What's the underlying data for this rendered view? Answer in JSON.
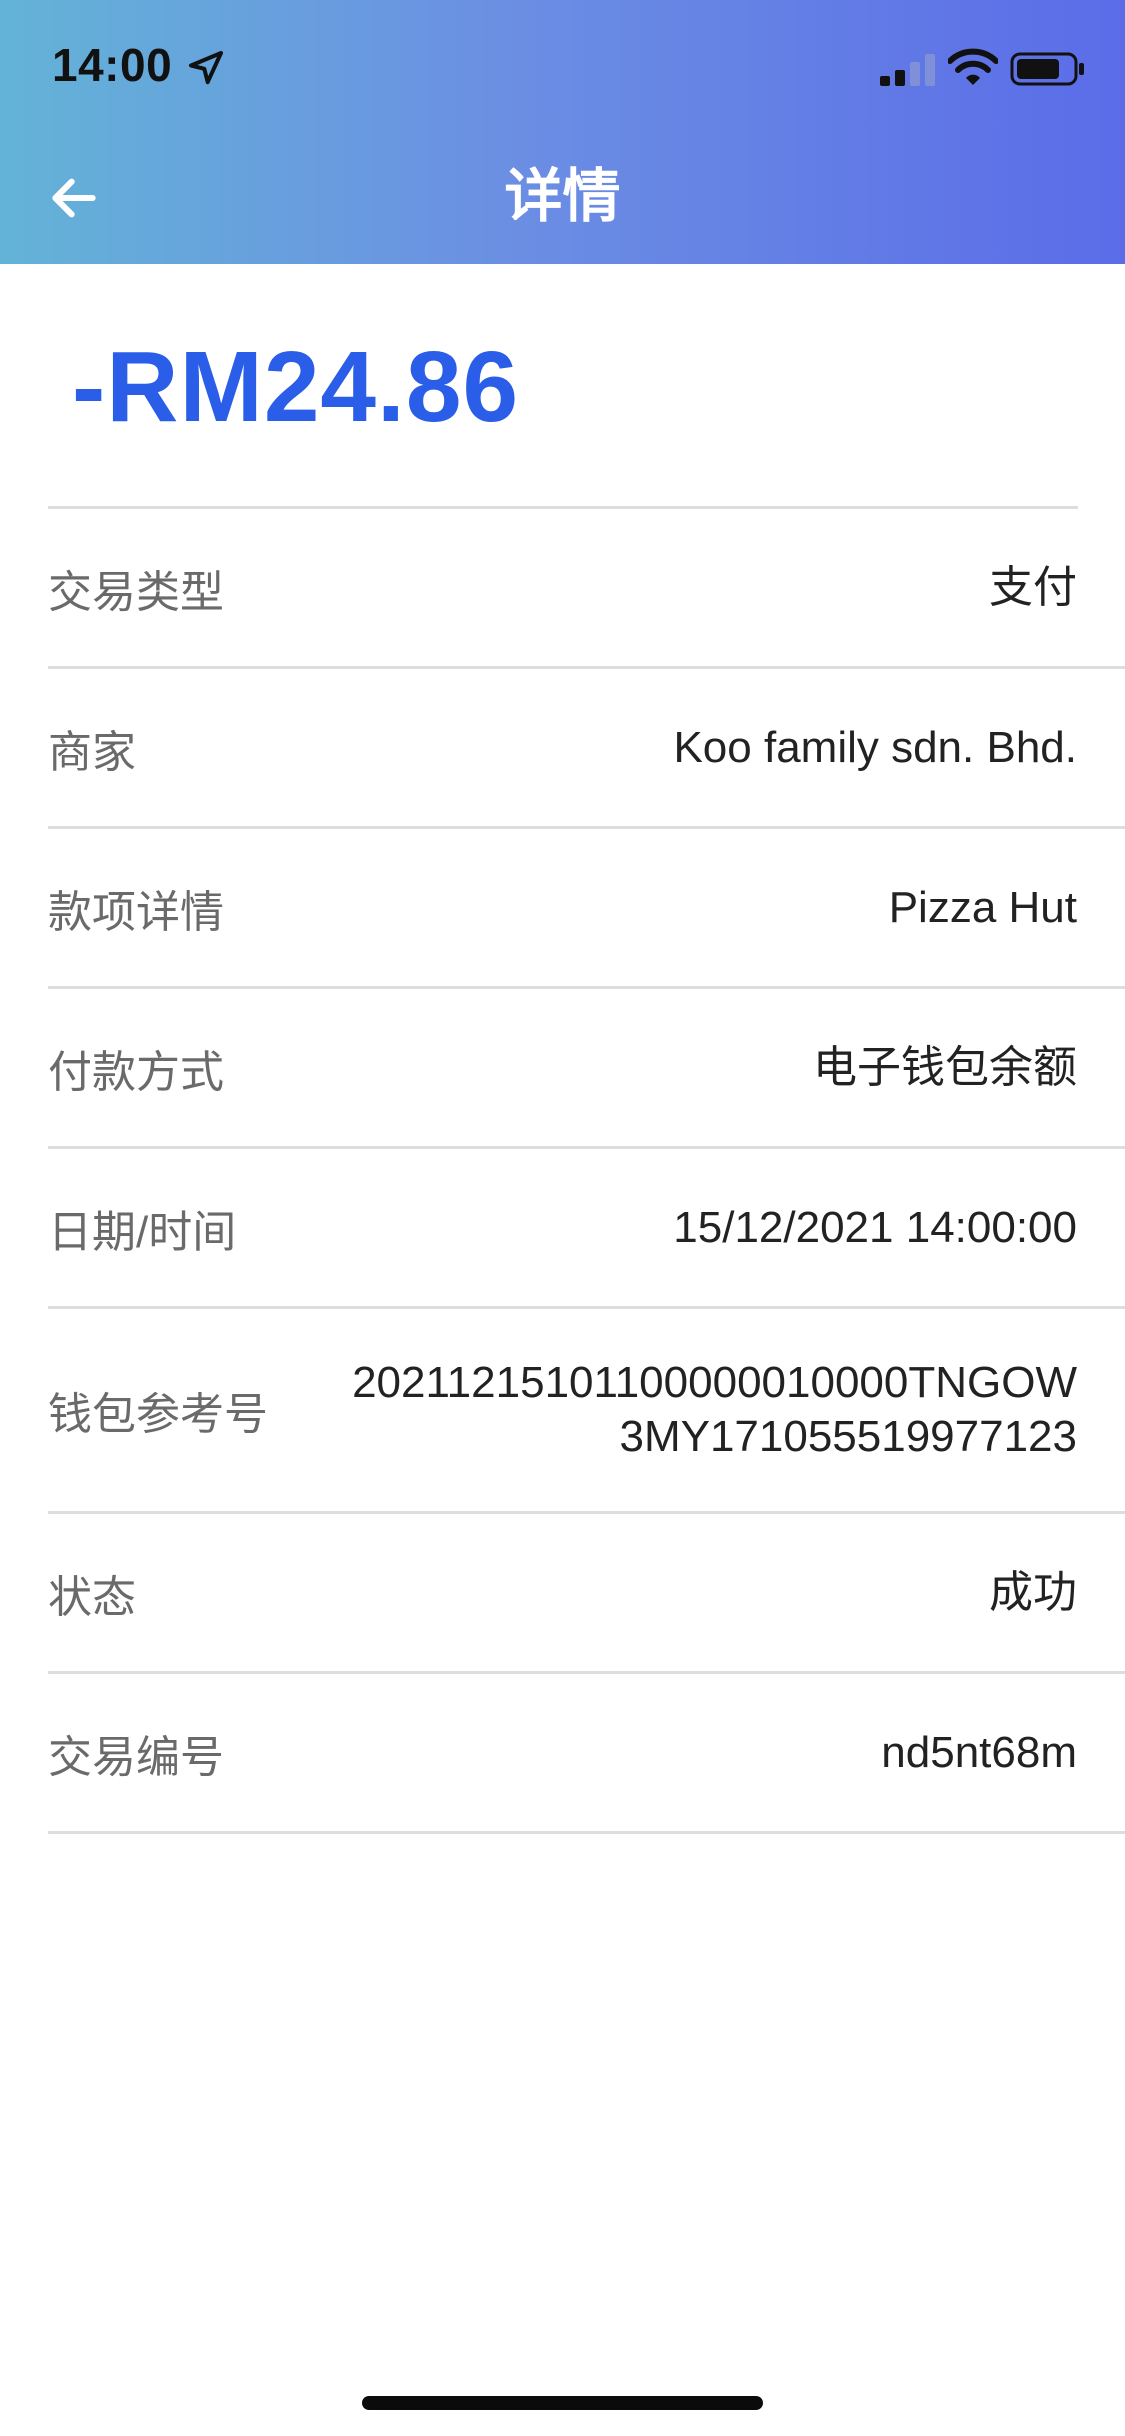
{
  "status_bar": {
    "time": "14:00",
    "icons": [
      "location-arrow-icon",
      "cellular-signal-icon",
      "wifi-icon",
      "battery-icon"
    ]
  },
  "header": {
    "title": "详情",
    "back_icon": "back-arrow-icon",
    "gradient_start": "#63b3d7",
    "gradient_end": "#5b6ce8"
  },
  "amount": {
    "text": "-RM24.86",
    "color": "#2a5ee8"
  },
  "details": [
    {
      "label": "交易类型",
      "value": "支付"
    },
    {
      "label": "商家",
      "value": "Koo family sdn. Bhd."
    },
    {
      "label": "款项详情",
      "value": "Pizza Hut"
    },
    {
      "label": "付款方式",
      "value": "电子钱包余额"
    },
    {
      "label": "日期/时间",
      "value": "15/12/2021 14:00:00"
    },
    {
      "label": "钱包参考号",
      "value": "20211215101100000010000TNGOW3MY171055519977123"
    },
    {
      "label": "状态",
      "value": "成功"
    },
    {
      "label": "交易编号",
      "value": "nd5nt68m"
    }
  ]
}
